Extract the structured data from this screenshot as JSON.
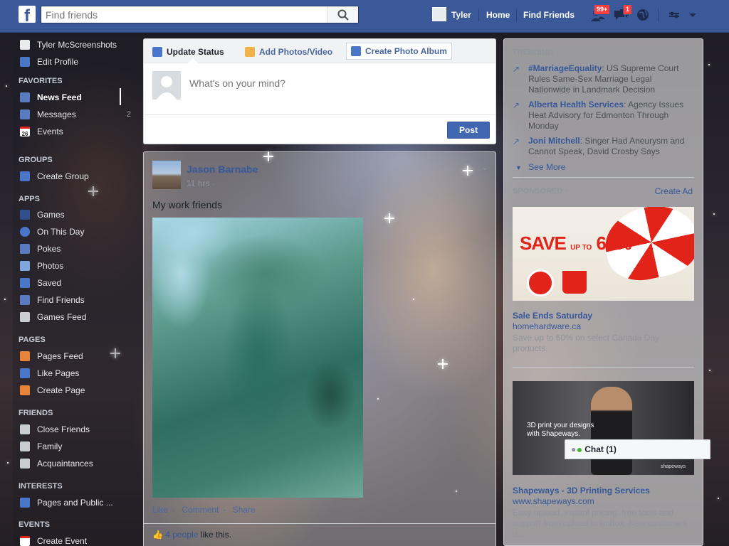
{
  "topbar": {
    "logo": "f",
    "search_placeholder": "Find friends",
    "user_name": "Tyler",
    "home": "Home",
    "find_friends": "Find Friends",
    "friend_requests_badge": "99+",
    "messages_badge": "1"
  },
  "sidebar": {
    "profile_name": "Tyler McScreenshots",
    "edit_profile": "Edit Profile",
    "favorites_header": "FAVORITES",
    "favorites": [
      {
        "label": "News Feed"
      },
      {
        "label": "Messages",
        "count": "2"
      },
      {
        "label": "Events",
        "icon_text": "26"
      }
    ],
    "groups_header": "GROUPS",
    "groups": [
      {
        "label": "Create Group"
      }
    ],
    "apps_header": "APPS",
    "apps": [
      {
        "label": "Games"
      },
      {
        "label": "On This Day"
      },
      {
        "label": "Pokes"
      },
      {
        "label": "Photos"
      },
      {
        "label": "Saved"
      },
      {
        "label": "Find Friends"
      },
      {
        "label": "Games Feed"
      }
    ],
    "pages_header": "PAGES",
    "pages": [
      {
        "label": "Pages Feed"
      },
      {
        "label": "Like Pages"
      },
      {
        "label": "Create Page"
      }
    ],
    "friends_header": "FRIENDS",
    "friends": [
      {
        "label": "Close Friends"
      },
      {
        "label": "Family"
      },
      {
        "label": "Acquaintances"
      }
    ],
    "interests_header": "INTERESTS",
    "interests": [
      {
        "label": "Pages and Public ..."
      }
    ],
    "events_header": "EVENTS",
    "events": [
      {
        "label": "Create Event"
      }
    ]
  },
  "composer": {
    "tab_status": "Update Status",
    "tab_photos": "Add Photos/Video",
    "tab_album": "Create Photo Album",
    "placeholder": "What's on your mind?",
    "post_button": "Post"
  },
  "story": {
    "author": "Jason Barnabe",
    "time": "11 hrs",
    "text": "My work friends",
    "actions": [
      "Like",
      "Comment",
      "Share"
    ],
    "likes_count": "4 people",
    "likes_suffix": " like this."
  },
  "right": {
    "trending_header": "TRENDING",
    "trending": [
      {
        "topic": "#MarriageEquality",
        "desc": ": US Supreme Court Rules Same-Sex Marriage Legal Nationwide in Landmark Decision"
      },
      {
        "topic": "Alberta Health Services",
        "desc": ": Agency Issues Heat Advisory for Edmonton Through Monday"
      },
      {
        "topic": "Joni Mitchell",
        "desc": ": Singer Had Aneurysm and Cannot Speak, David Crosby Says"
      }
    ],
    "see_more": "See More",
    "sponsored_header": "SPONSORED",
    "create_ad": "Create Ad",
    "ads": [
      {
        "image_text_save": "SAVE",
        "image_text_upto": "UP TO",
        "image_text_pct": "60%",
        "title": "Sale Ends Saturday",
        "url": "homehardware.ca",
        "desc": "Save up to 60% on select Canada Day products."
      },
      {
        "image_text": "3D print your designs with Shapeways.",
        "image_brand": "shapeways",
        "title": "Shapeways - 3D Printing Services",
        "url": "www.shapeways.com",
        "desc": "Easy upload, instant pricing, free tools and support from upload to unbox. New customers u..."
      }
    ]
  },
  "chat": {
    "label": "Chat (1)"
  },
  "colors": {
    "brand_blue": "#3b5998",
    "link_blue": "#365899",
    "badge_red": "#fa3e3e",
    "online_green": "#42b72a"
  },
  "icons": {
    "search": "search-icon",
    "friend_requests": "friend-requests-icon",
    "messages": "messages-icon",
    "notifications": "globe-icon",
    "settings": "settings-icon",
    "trend": "trending-arrow-icon"
  }
}
